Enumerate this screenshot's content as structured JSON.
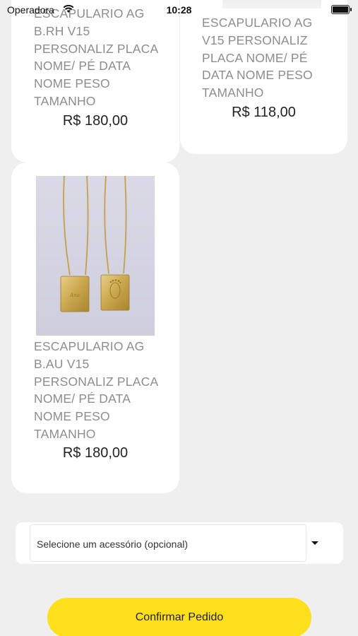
{
  "status_bar": {
    "carrier": "Operadora",
    "time": "10:28"
  },
  "products": [
    {
      "name": "ESCAPULARIO AG B.RH V15 PERSONALIZ PLACA NOME/ PÉ DATA NOME PESO TAMANHO",
      "price": "R$ 180,00"
    },
    {
      "name": "ESCAPULARIO AG V15 PERSONALIZ PLACA NOME/ PÉ DATA NOME PESO TAMANHO",
      "price": "R$ 118,00"
    },
    {
      "name": "ESCAPULARIO AG B.AU V15 PERSONALIZ PLACA NOME/ PÉ DATA NOME PESO TAMANHO",
      "price": "R$ 180,00",
      "image": "gold-scapular-necklace-photo"
    }
  ],
  "accessory_select": {
    "selected": "Selecione um acessório (opcional)",
    "icon": "caret-down-icon"
  },
  "confirm_button": {
    "label": "Confirmar Pedido",
    "color": "#fddf1b"
  }
}
